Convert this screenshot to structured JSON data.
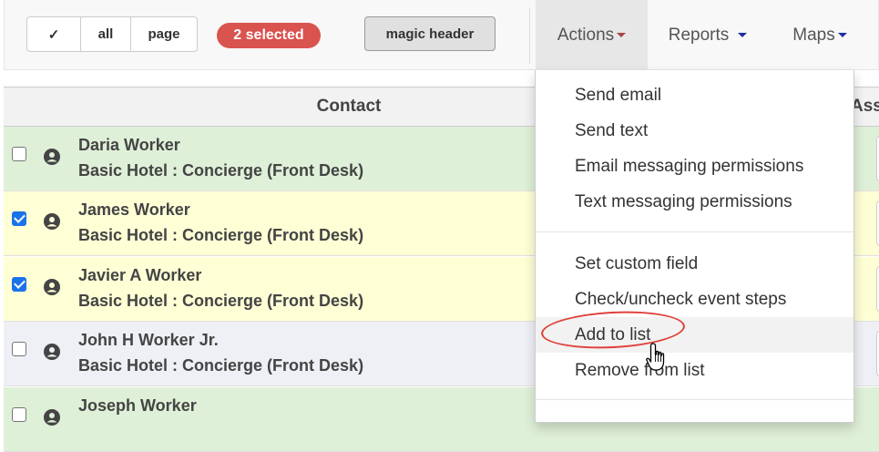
{
  "toolbar": {
    "select_buttons": [
      "✓",
      "all",
      "page"
    ],
    "selected_badge": "2 selected",
    "magic_header": "magic header",
    "nav": [
      "Actions",
      "Reports",
      "Maps"
    ]
  },
  "table": {
    "headers": {
      "contact": "Contact",
      "assigned_partial": "Ass"
    },
    "rows": [
      {
        "name": "Daria Worker",
        "role": "Basic Hotel : Concierge (Front Desk)",
        "checked": false,
        "color": "green"
      },
      {
        "name": "James Worker",
        "role": "Basic Hotel : Concierge (Front Desk)",
        "checked": true,
        "color": "yellow"
      },
      {
        "name": "Javier A Worker",
        "role": "Basic Hotel : Concierge (Front Desk)",
        "checked": true,
        "color": "yellow"
      },
      {
        "name": "John H Worker Jr.",
        "role": "Basic Hotel : Concierge (Front Desk)",
        "checked": false,
        "color": "gray"
      },
      {
        "name": "Joseph Worker",
        "role": "",
        "checked": false,
        "color": "green"
      }
    ]
  },
  "actions_menu": {
    "group1": [
      "Send email",
      "Send text",
      "Email messaging permissions",
      "Text messaging permissions"
    ],
    "group2": [
      "Set custom field",
      "Check/uncheck event steps",
      "Add to list",
      "Remove from list"
    ]
  },
  "colors": {
    "badge": "#d9534f",
    "highlight_ring": "#e0403a",
    "checkbox": "#1a73e8"
  },
  "icons": {
    "avatar": "person-circle-icon",
    "cursor": "hand-pointer-icon"
  }
}
